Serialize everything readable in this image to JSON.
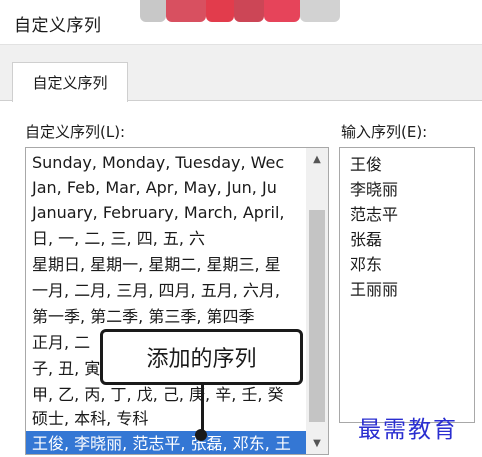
{
  "window": {
    "title": "自定义序列"
  },
  "tabs": [
    {
      "label": "自定义序列"
    }
  ],
  "custom_lists": {
    "label": "自定义序列(L):",
    "items": [
      "Sunday, Monday, Tuesday, Wec",
      "Jan, Feb, Mar, Apr, May, Jun, Ju",
      "January, February, March, April,",
      "日, 一, 二, 三, 四, 五, 六",
      "星期日, 星期一, 星期二, 星期三, 星",
      "一月, 二月, 三月, 四月, 五月, 六月,",
      "第一季, 第二季, 第三季, 第四季",
      "正月, 二",
      "子, 丑, 寅",
      "甲, 乙, 丙, 丁, 戊, 己, 庚, 辛, 壬, 癸",
      "硕士, 本科, 专科",
      "王俊, 李晓丽, 范志平, 张磊, 邓东, 王"
    ],
    "selected_index": 11
  },
  "input_entries": {
    "label": "输入序列(E):",
    "entries": [
      "王俊",
      "李晓丽",
      "范志平",
      "张磊",
      "邓东",
      "王丽丽"
    ]
  },
  "annotation": {
    "text": "添加的序列"
  },
  "watermark": {
    "text": "最需教育"
  },
  "colors": {
    "selection": "#3477d4",
    "watermark": "#2a2ed0",
    "redacted_bar": [
      "#e03a4a",
      "#c9c9c9"
    ]
  },
  "icons": {
    "scroll_up": "chevron-up-icon",
    "scroll_down": "chevron-down-icon"
  }
}
